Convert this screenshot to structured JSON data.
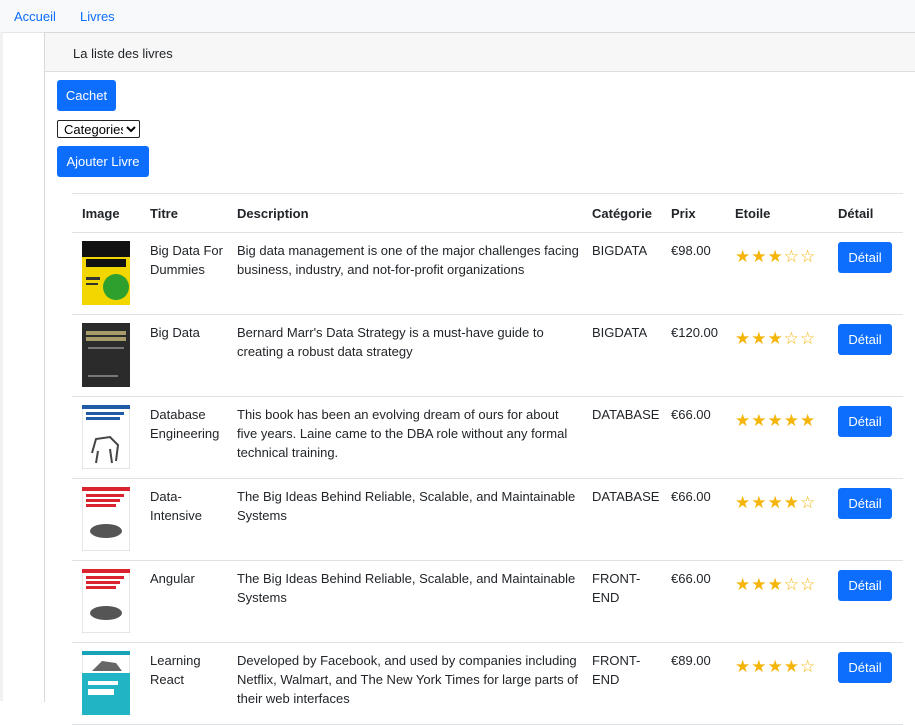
{
  "nav": {
    "home": "Accueil",
    "books": "Livres"
  },
  "card": {
    "header": "La liste des livres"
  },
  "buttons": {
    "cachet": "Cachet",
    "add_book": "Ajouter Livre"
  },
  "category_select": {
    "selected": "Categories"
  },
  "table": {
    "headers": [
      "Image",
      "Titre",
      "Description",
      "Catégorie",
      "Prix",
      "Etoile",
      "Détail"
    ],
    "detail_label": "Détail",
    "rows": [
      {
        "title": "Big Data For Dummies",
        "description": "Big data management is one of the major challenges facing business, industry, and not-for-profit organizations",
        "category": "BIGDATA",
        "price": "€98.00",
        "stars": "★★★☆☆",
        "rating": 3
      },
      {
        "title": "Big Data",
        "description": "Bernard Marr's Data Strategy is a must-have guide to creating a robust data strategy",
        "category": "BIGDATA",
        "price": "€120.00",
        "stars": "★★★☆☆",
        "rating": 3
      },
      {
        "title": "Database Engineering",
        "description": "This book has been an evolving dream of ours for about five years. Laine came to the DBA role without any formal technical training.",
        "category": "DATABASE",
        "price": "€66.00",
        "stars": "★★★★★",
        "rating": 5
      },
      {
        "title": "Data-Intensive",
        "description": "The Big Ideas Behind Reliable, Scalable, and Maintainable Systems",
        "category": "DATABASE",
        "price": "€66.00",
        "stars": "★★★★☆",
        "rating": 4
      },
      {
        "title": "Angular",
        "description": "The Big Ideas Behind Reliable, Scalable, and Maintainable Systems",
        "category": "FRONT-END",
        "price": "€66.00",
        "stars": "★★★☆☆",
        "rating": 3
      },
      {
        "title": "Learning React",
        "description": "Developed by Facebook, and used by companies including Netflix, Walmart, and The New York Times for large parts of their web interfaces",
        "category": "FRONT-END",
        "price": "€89.00",
        "stars": "★★★★☆",
        "rating": 4
      }
    ]
  },
  "colors": {
    "primary": "#0d6efd",
    "star": "#f5b50a"
  }
}
